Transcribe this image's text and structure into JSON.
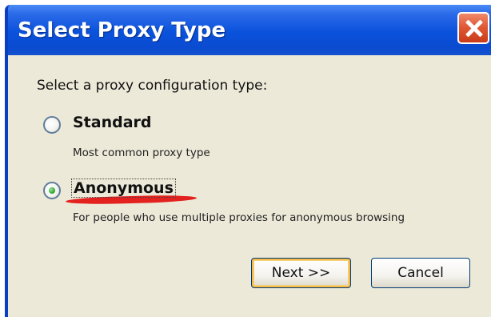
{
  "window": {
    "title": "Select Proxy Type"
  },
  "dialog": {
    "prompt": "Select a proxy configuration type:",
    "options": [
      {
        "label": "Standard",
        "description": "Most common proxy type",
        "selected": false
      },
      {
        "label": "Anonymous",
        "description": "For people who use multiple proxies for anonymous browsing",
        "selected": true
      }
    ]
  },
  "buttons": {
    "next": "Next >>",
    "cancel": "Cancel"
  },
  "colors": {
    "titlebar": "#0a52dc",
    "dialog_bg": "#ece9d8",
    "close_button": "#e05a36",
    "annotation_underline": "#e21010",
    "radio_selected_dot": "#33a833"
  },
  "icons": {
    "close": "close-icon"
  }
}
